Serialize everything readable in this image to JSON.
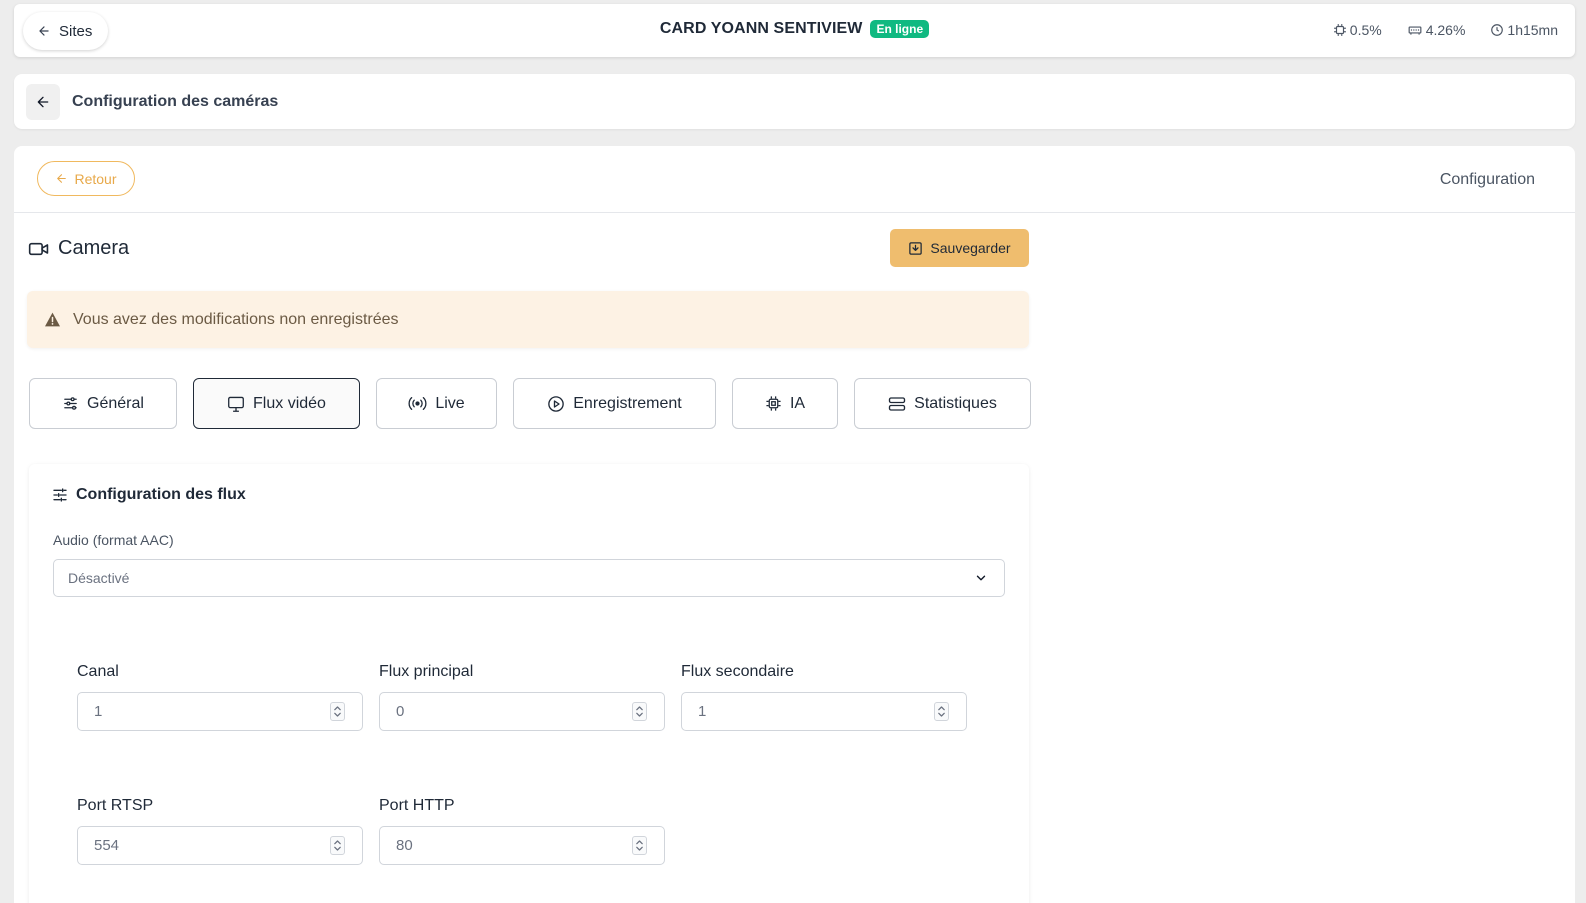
{
  "topbar": {
    "back_label": "Sites",
    "site_name": "CARD YOANN SENTIVIEW",
    "status": "En ligne",
    "metrics": {
      "cpu": "0.5%",
      "memory": "4.26%",
      "uptime": "1h15mn"
    }
  },
  "breadcrumb": {
    "title": "Configuration des caméras"
  },
  "header": {
    "retour_label": "Retour",
    "section_label": "Configuration"
  },
  "camera": {
    "title": "Camera",
    "save_label": "Sauvegarder",
    "unsaved_warning": "Vous avez des modifications non enregistrées"
  },
  "tabs": [
    {
      "label": "Général",
      "icon": "sliders-icon"
    },
    {
      "label": "Flux vidéo",
      "icon": "monitor-icon",
      "active": true
    },
    {
      "label": "Live",
      "icon": "broadcast-icon"
    },
    {
      "label": "Enregistrement",
      "icon": "play-circle-icon"
    },
    {
      "label": "IA",
      "icon": "chip-icon"
    },
    {
      "label": "Statistiques",
      "icon": "server-icon"
    }
  ],
  "flux": {
    "title": "Configuration des flux",
    "audio_label": "Audio (format AAC)",
    "audio_value": "Désactivé",
    "fields": {
      "canal": {
        "label": "Canal",
        "value": "1"
      },
      "principal": {
        "label": "Flux principal",
        "value": "0"
      },
      "secondaire": {
        "label": "Flux secondaire",
        "value": "1"
      },
      "rtsp": {
        "label": "Port RTSP",
        "value": "554"
      },
      "http": {
        "label": "Port HTTP",
        "value": "80"
      }
    }
  },
  "colors": {
    "accent": "#efbd6e",
    "status_green": "#10b981",
    "alert_bg": "#fdf2e4"
  }
}
